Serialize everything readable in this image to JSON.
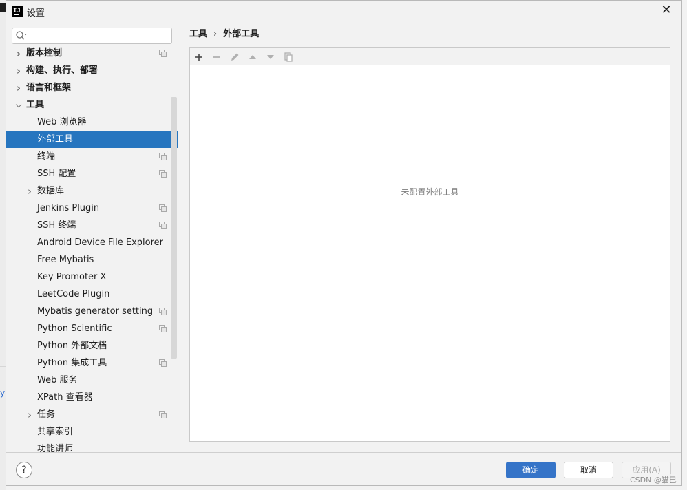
{
  "window": {
    "title": "设置",
    "app_icon_text": "IJ"
  },
  "search": {
    "placeholder": ""
  },
  "tree": [
    {
      "label": "版本控制",
      "chevron": true,
      "level": 0,
      "bold": true,
      "project": true
    },
    {
      "label": "构建、执行、部署",
      "chevron": true,
      "level": 0,
      "bold": true,
      "project": false
    },
    {
      "label": "语言和框架",
      "chevron": true,
      "level": 0,
      "bold": true,
      "project": false
    },
    {
      "label": "工具",
      "chevron": true,
      "expanded": true,
      "level": 0,
      "bold": true,
      "project": false
    },
    {
      "label": "Web 浏览器",
      "chevron": false,
      "level": 1,
      "project": false
    },
    {
      "label": "外部工具",
      "chevron": false,
      "level": 1,
      "selected": true,
      "project": false
    },
    {
      "label": "终端",
      "chevron": false,
      "level": 1,
      "project": true
    },
    {
      "label": "SSH 配置",
      "chevron": false,
      "level": 1,
      "project": true
    },
    {
      "label": "数据库",
      "chevron": true,
      "level": 1,
      "project": false
    },
    {
      "label": "Jenkins Plugin",
      "chevron": false,
      "level": 1,
      "project": true
    },
    {
      "label": "SSH 终端",
      "chevron": false,
      "level": 1,
      "project": true
    },
    {
      "label": "Android Device File Explorer",
      "chevron": false,
      "level": 1,
      "project": false
    },
    {
      "label": "Free Mybatis",
      "chevron": false,
      "level": 1,
      "project": false
    },
    {
      "label": "Key Promoter X",
      "chevron": false,
      "level": 1,
      "project": false
    },
    {
      "label": "LeetCode Plugin",
      "chevron": false,
      "level": 1,
      "project": false
    },
    {
      "label": "Mybatis generator setting",
      "chevron": false,
      "level": 1,
      "project": true
    },
    {
      "label": "Python Scientific",
      "chevron": false,
      "level": 1,
      "project": true
    },
    {
      "label": "Python 外部文档",
      "chevron": false,
      "level": 1,
      "project": false
    },
    {
      "label": "Python 集成工具",
      "chevron": false,
      "level": 1,
      "project": true
    },
    {
      "label": "Web 服务",
      "chevron": false,
      "level": 1,
      "project": false
    },
    {
      "label": "XPath 查看器",
      "chevron": false,
      "level": 1,
      "project": false
    },
    {
      "label": "任务",
      "chevron": true,
      "level": 1,
      "project": true
    },
    {
      "label": "共享索引",
      "chevron": false,
      "level": 1,
      "project": false
    },
    {
      "label": "功能讲师",
      "chevron": false,
      "level": 1,
      "project": false
    }
  ],
  "breadcrumb": {
    "parent": "工具",
    "separator": "›",
    "current": "外部工具"
  },
  "toolbar": [
    "add-icon",
    "remove-icon",
    "edit-icon",
    "move-up-icon",
    "move-down-icon",
    "copy-icon"
  ],
  "content": {
    "empty_text": "未配置外部工具"
  },
  "footer": {
    "help": "?",
    "ok": "确定",
    "cancel": "取消",
    "apply": "应用(A)"
  },
  "watermark": "CSDN @猫巳",
  "background": {
    "link_fragment": "y"
  },
  "colors": {
    "selection": "#2675bf",
    "primary_button": "#3574c8"
  }
}
